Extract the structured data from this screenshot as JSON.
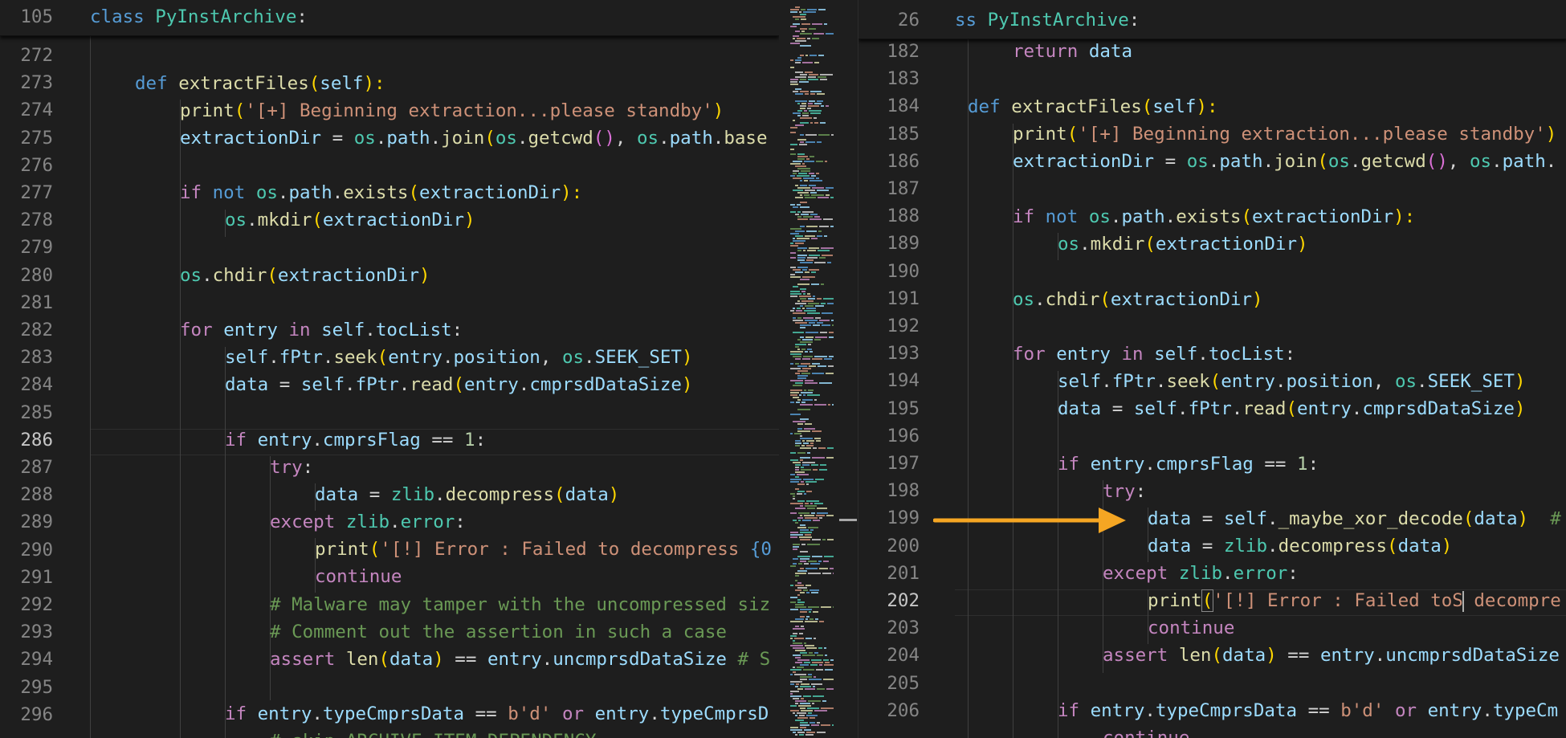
{
  "accent": "#f5a623",
  "left_pane": {
    "sticky": {
      "line": "105",
      "keyword": "class",
      "class_name": "PyInstArchive",
      "punct": ":"
    },
    "active_line": "286",
    "line_numbers": [
      "272",
      "273",
      "274",
      "275",
      "276",
      "277",
      "278",
      "279",
      "280",
      "281",
      "282",
      "283",
      "284",
      "285",
      "286",
      "287",
      "288",
      "289",
      "290",
      "291",
      "292",
      "293",
      "294",
      "295",
      "296"
    ],
    "lines": {
      "l273": {
        "kw": "def",
        "fn": "extractFiles",
        "p": "(",
        "self": "self",
        "p2": "):"
      },
      "l274": {
        "fn": "print",
        "p": "(",
        "str": "'[+] Beginning extraction...please standby'",
        "p2": ")"
      },
      "l275": {
        "var": "extractionDir",
        "eq": " = ",
        "os": "os",
        "dot1": ".",
        "path": "path",
        "dot2": ".",
        "join": "join",
        "p": "(",
        "os2": "os",
        "dot3": ".",
        "getcwd": "getcwd",
        "pp": "()",
        "comma": ", ",
        "os3": "os",
        "dot4": ".",
        "path2": "path",
        "dot5": ".",
        "base": "base"
      },
      "l277": {
        "if": "if",
        "not": "not",
        "os": "os",
        "dot1": ".",
        "path": "path",
        "dot2": ".",
        "exists": "exists",
        "p": "(",
        "arg": "extractionDir",
        "p2": "):"
      },
      "l278": {
        "os": "os",
        "dot": ".",
        "mkdir": "mkdir",
        "p": "(",
        "arg": "extractionDir",
        "p2": ")"
      },
      "l280": {
        "os": "os",
        "dot": ".",
        "chdir": "chdir",
        "p": "(",
        "arg": "extractionDir",
        "p2": ")"
      },
      "l282": {
        "for": "for",
        "entry": "entry",
        "in": "in",
        "self": "self",
        "dot": ".",
        "toc": "tocList",
        "colon": ":"
      },
      "l283": {
        "self": "self",
        "dot1": ".",
        "fptr": "fPtr",
        "dot2": ".",
        "seek": "seek",
        "p": "(",
        "entry": "entry",
        "dot3": ".",
        "pos": "position",
        "comma": ", ",
        "os": "os",
        "dot4": ".",
        "seekset": "SEEK_SET",
        "p2": ")"
      },
      "l284": {
        "data": "data",
        "eq": " = ",
        "self": "self",
        "dot1": ".",
        "fptr": "fPtr",
        "dot2": ".",
        "read": "read",
        "p": "(",
        "entry": "entry",
        "dot3": ".",
        "size": "cmprsdDataSize",
        "p2": ")"
      },
      "l286": {
        "if": "if",
        "entry": "entry",
        "dot": ".",
        "flag": "cmprsFlag",
        "eq": " == ",
        "num": "1",
        "colon": ":"
      },
      "l287": {
        "try": "try",
        "colon": ":"
      },
      "l288": {
        "data": "data",
        "eq": " = ",
        "zlib": "zlib",
        "dot": ".",
        "decompress": "decompress",
        "p": "(",
        "arg": "data",
        "p2": ")"
      },
      "l289": {
        "except": "except",
        "zlib": "zlib",
        "dot": ".",
        "error": "error",
        "colon": ":"
      },
      "l290": {
        "fn": "print",
        "p": "(",
        "str": "'[!] Error : Failed to decompress ",
        "brace": "{0"
      },
      "l291": {
        "continue": "continue"
      },
      "l292": {
        "cm": "# Malware may tamper with the uncompressed siz"
      },
      "l293": {
        "cm": "# Comment out the assertion in such a case"
      },
      "l294": {
        "assert": "assert",
        "len": "len",
        "p": "(",
        "data": "data",
        "p2": ")",
        "eq": " == ",
        "entry": "entry",
        "dot": ".",
        "size": "uncmprsdDataSize",
        "cm": " # S"
      },
      "l296": {
        "if": "if",
        "entry": "entry",
        "dot": ".",
        "type": "typeCmprsData",
        "eq": " == ",
        "str": "b'd'",
        "or": "or",
        "entry2": "entry",
        "dot2": ".",
        "type2": "typeCmprsD"
      },
      "l297": {
        "cm": "# skip ARCHIVE_ITEM_DEPENDENCY"
      }
    }
  },
  "right_pane": {
    "sticky": {
      "line": "26",
      "keyword": "ss",
      "class_name": "PyInstArchive",
      "punct": ":"
    },
    "active_line": "202",
    "line_numbers": [
      "182",
      "183",
      "184",
      "185",
      "186",
      "187",
      "188",
      "189",
      "190",
      "191",
      "192",
      "193",
      "194",
      "195",
      "196",
      "197",
      "198",
      "199",
      "200",
      "201",
      "202",
      "203",
      "204",
      "205",
      "206"
    ],
    "lines": {
      "l182": {
        "ret": "return",
        "data": "data"
      },
      "l184": {
        "kw": "def",
        "fn": "extractFiles",
        "p": "(",
        "self": "self",
        "p2": "):"
      },
      "l185": {
        "fn": "print",
        "p": "(",
        "str": "'[+] Beginning extraction...please standby'",
        "p2": ")"
      },
      "l186": {
        "var": "extractionDir",
        "eq": " = ",
        "os": "os",
        "dot1": ".",
        "path": "path",
        "dot2": ".",
        "join": "join",
        "p": "(",
        "os2": "os",
        "dot3": ".",
        "getcwd": "getcwd",
        "pp": "()",
        "comma": ", ",
        "os3": "os",
        "dot4": ".",
        "path2": "path",
        "dot5": "."
      },
      "l188": {
        "if": "if",
        "not": "not",
        "os": "os",
        "dot1": ".",
        "path": "path",
        "dot2": ".",
        "exists": "exists",
        "p": "(",
        "arg": "extractionDir",
        "p2": "):"
      },
      "l189": {
        "os": "os",
        "dot": ".",
        "mkdir": "mkdir",
        "p": "(",
        "arg": "extractionDir",
        "p2": ")"
      },
      "l191": {
        "os": "os",
        "dot": ".",
        "chdir": "chdir",
        "p": "(",
        "arg": "extractionDir",
        "p2": ")"
      },
      "l193": {
        "for": "for",
        "entry": "entry",
        "in": "in",
        "self": "self",
        "dot": ".",
        "toc": "tocList",
        "colon": ":"
      },
      "l194": {
        "self": "self",
        "dot1": ".",
        "fptr": "fPtr",
        "dot2": ".",
        "seek": "seek",
        "p": "(",
        "entry": "entry",
        "dot3": ".",
        "pos": "position",
        "comma": ", ",
        "os": "os",
        "dot4": ".",
        "seekset": "SEEK_SET",
        "p2": ")"
      },
      "l195": {
        "data": "data",
        "eq": " = ",
        "self": "self",
        "dot1": ".",
        "fptr": "fPtr",
        "dot2": ".",
        "read": "read",
        "p": "(",
        "entry": "entry",
        "dot3": ".",
        "size": "cmprsdDataSize",
        "p2": ")"
      },
      "l197": {
        "if": "if",
        "entry": "entry",
        "dot": ".",
        "flag": "cmprsFlag",
        "eq": " == ",
        "num": "1",
        "colon": ":"
      },
      "l198": {
        "try": "try",
        "colon": ":"
      },
      "l199": {
        "data": "data",
        "eq": " = ",
        "self": "self",
        "dot": ".",
        "fn": "_maybe_xor_decode",
        "p": "(",
        "arg": "data",
        "p2": ")",
        "cm": "  #"
      },
      "l200": {
        "data": "data",
        "eq": " = ",
        "zlib": "zlib",
        "dot": ".",
        "decompress": "decompress",
        "p": "(",
        "arg": "data",
        "p2": ")"
      },
      "l201": {
        "except": "except",
        "zlib": "zlib",
        "dot": ".",
        "error": "error",
        "colon": ":"
      },
      "l202": {
        "fn": "print",
        "p": "(",
        "str1": "'[!] Error : Failed toS",
        "str2": " decompre"
      },
      "l203": {
        "continue": "continue"
      },
      "l204": {
        "assert": "assert",
        "len": "len",
        "p": "(",
        "data": "data",
        "p2": ")",
        "eq": " == ",
        "entry": "entry",
        "dot": ".",
        "size": "uncmprsdDataSize"
      },
      "l206": {
        "if": "if",
        "entry": "entry",
        "dot": ".",
        "type": "typeCmprsData",
        "eq": " == ",
        "str": "b'd'",
        "or": "or",
        "entry2": "entry",
        "dot2": ".",
        "type2": "typeCm"
      },
      "l207": {
        "continue": "continue"
      }
    }
  }
}
